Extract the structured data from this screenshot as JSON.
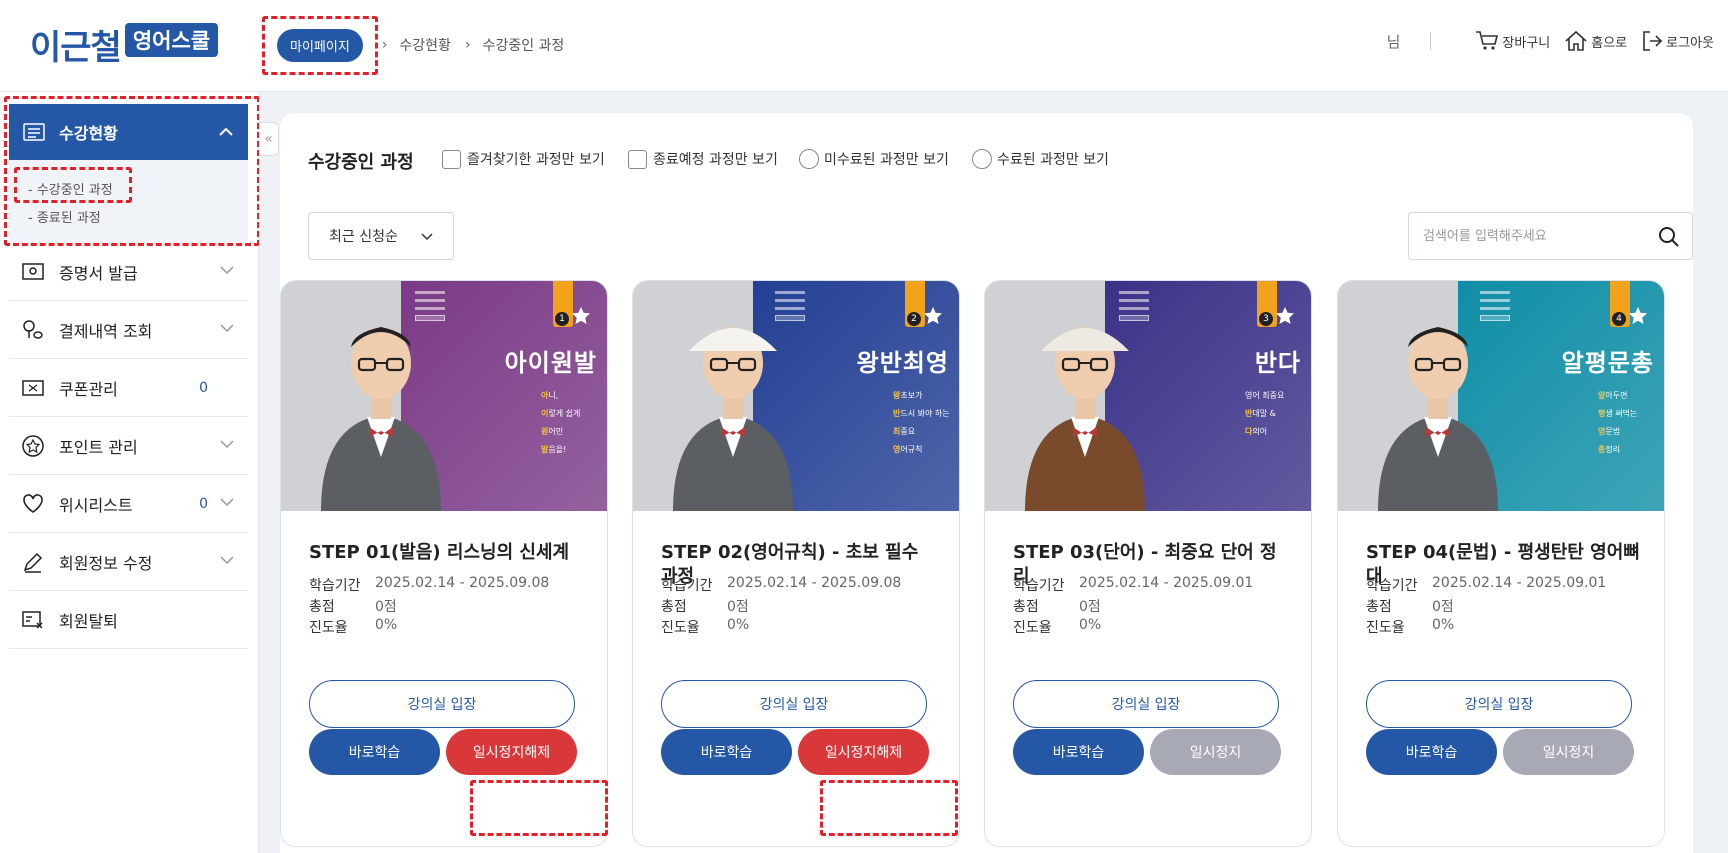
{
  "header": {
    "logo_name": "이근철",
    "logo_badge": "영어스쿨",
    "breadcrumb": [
      "마이페이지",
      "수강현황",
      "수강중인 과정"
    ],
    "user_suffix": "님",
    "cart": "장바구니",
    "home": "홈으로",
    "logout": "로그아웃"
  },
  "sidebar": {
    "active": "수강현황",
    "subitems": [
      "- 수강중인 과정",
      "- 종료된 과정"
    ],
    "items": [
      {
        "label": "증명서 발급",
        "icon": "certificate-icon"
      },
      {
        "label": "결제내역 조회",
        "icon": "payment-icon"
      },
      {
        "label": "쿠폰관리",
        "icon": "coupon-icon",
        "count": "0"
      },
      {
        "label": "포인트 관리",
        "icon": "point-icon"
      },
      {
        "label": "위시리스트",
        "icon": "heart-icon",
        "count": "0"
      },
      {
        "label": "회원정보 수정",
        "icon": "pencil-icon"
      },
      {
        "label": "회원탈퇴",
        "icon": "withdraw-icon"
      }
    ]
  },
  "main": {
    "title": "수강중인 과정",
    "filters": [
      "즐겨찾기한 과정만 보기",
      "종료예정 과정만 보기",
      "미수료된 과정만 보기",
      "수료된 과정만 보기"
    ],
    "sort": "최근 신청순",
    "search_placeholder": "검색어를 입력해주세요",
    "labels": {
      "period": "학습기간",
      "score": "총점",
      "progress": "진도율"
    },
    "enter_btn": "강의실 입장",
    "study_btn": "바로학습",
    "courses": [
      {
        "book_title": "아이원발",
        "tag_num": "1",
        "tagline": [
          [
            "아",
            "니,"
          ],
          [
            "이",
            "렇게 쉽게"
          ],
          [
            "원",
            "어민"
          ],
          [
            "발",
            "음을!"
          ]
        ],
        "title": "STEP 01(발음) 리스닝의 신세계",
        "period": "2025.02.14 - 2025.09.08",
        "score": "0점",
        "progress": "0%",
        "pause_btn": "일시정지해제",
        "accent": "#7a3a86"
      },
      {
        "book_title": "왕반최영",
        "tag_num": "2",
        "tagline": [
          [
            "왕",
            "초보가"
          ],
          [
            "반",
            "드시 봐야 하는"
          ],
          [
            "최",
            "중요"
          ],
          [
            "영",
            "어규칙"
          ]
        ],
        "title": "STEP 02(영어규칙) - 초보 필수 과정",
        "period": "2025.02.14 - 2025.09.08",
        "score": "0점",
        "progress": "0%",
        "pause_btn": "일시정지해제",
        "accent": "#243f94"
      },
      {
        "book_title": "반다",
        "tag_num": "3",
        "tagline": [
          [
            "",
            "영어 최중요"
          ],
          [
            "반",
            "대말 &"
          ],
          [
            "다",
            "의어"
          ]
        ],
        "title": "STEP 03(단어) - 최중요 단어 정리",
        "period": "2025.02.14 - 2025.09.01",
        "score": "0점",
        "progress": "0%",
        "pause_btn": "일시정지",
        "accent": "#3b3288"
      },
      {
        "book_title": "알평문총",
        "tag_num": "4",
        "tagline": [
          [
            "알",
            "아두면"
          ],
          [
            "평",
            "생 써먹는"
          ],
          [
            "영",
            "문법"
          ],
          [
            "총",
            "정리"
          ]
        ],
        "title": "STEP 04(문법) - 평생탄탄 영어뼈대",
        "period": "2025.02.14 - 2025.09.01",
        "score": "0점",
        "progress": "0%",
        "pause_btn": "일시정지",
        "accent": "#0f8ea6"
      }
    ]
  }
}
